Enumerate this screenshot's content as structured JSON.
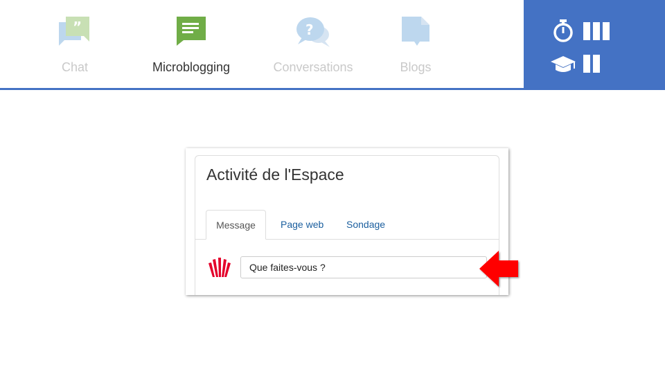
{
  "nav": {
    "items": [
      {
        "label": "Chat",
        "icon": "chat-icon"
      },
      {
        "label": "Microblogging",
        "icon": "microblog-icon",
        "active": true
      },
      {
        "label": "Conversations",
        "icon": "conversations-icon"
      },
      {
        "label": "Blogs",
        "icon": "blogs-icon"
      }
    ]
  },
  "blue_box": {
    "icons": [
      "stopwatch-icon",
      "graduation-cap-icon"
    ],
    "stopwatch_bars": 3,
    "cap_bars": 2
  },
  "colors": {
    "accent": "#4472c4",
    "microblog_green": "#70ad47",
    "chat_green": "#c8e0b4",
    "chat_blue": "#bdd7ee",
    "conv_blue": "#bdd7ee",
    "tab_link": "#1a5e9e",
    "arrow_red": "#ff0000"
  },
  "card": {
    "title": "Activité de l'Espace",
    "tabs": [
      {
        "label": "Message",
        "active": true
      },
      {
        "label": "Page web"
      },
      {
        "label": "Sondage"
      }
    ],
    "input_value": "Que faites-vous ?"
  }
}
